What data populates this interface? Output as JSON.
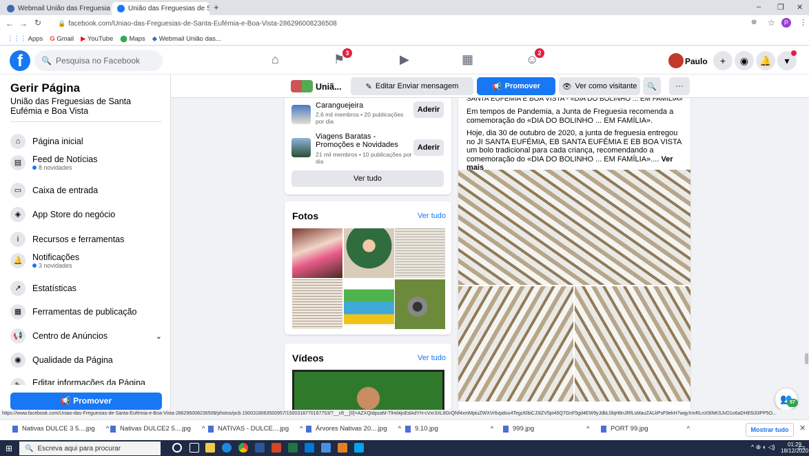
{
  "browser": {
    "tabs": [
      {
        "title": "Webmail União das Freguesias de..."
      },
      {
        "title": "União das Freguesias de Santa E..."
      }
    ],
    "new_tab": "+",
    "url": "facebook.com/Uniao-das-Freguesias-de-Santa-Eufémia-e-Boa-Vista-286296008236508",
    "bookmarks": [
      "Apps",
      "Gmail",
      "YouTube",
      "Maps",
      "Webmail União das..."
    ],
    "profile_initial": "P"
  },
  "header": {
    "search_placeholder": "Pesquisa no Facebook",
    "notif_badge_1": "3",
    "notif_badge_2": "2",
    "user": "Paulo"
  },
  "sidebar": {
    "title": "Gerir Página",
    "page_name": "União das Freguesias de Santa Eufémia e Boa Vista",
    "items": [
      {
        "label": "Página inicial",
        "sub": ""
      },
      {
        "label": "Feed de Notícias",
        "sub": "8 novidades"
      },
      {
        "label": "Caixa de entrada",
        "sub": ""
      },
      {
        "label": "App Store do negócio",
        "sub": ""
      },
      {
        "label": "Recursos e ferramentas",
        "sub": ""
      },
      {
        "label": "Notificações",
        "sub": "3 novidades"
      },
      {
        "label": "Estatísticas",
        "sub": ""
      },
      {
        "label": "Ferramentas de publicação",
        "sub": ""
      },
      {
        "label": "Centro de Anúncios",
        "sub": ""
      },
      {
        "label": "Qualidade da Página",
        "sub": ""
      },
      {
        "label": "Editar informações da Página",
        "sub": ""
      }
    ],
    "promote": "Promover"
  },
  "pagebar": {
    "short_name": "Uniã...",
    "edit_button": "Editar Enviar mensagem",
    "promote_button": "Promover",
    "visitor_button": "Ver como visitante",
    "more": "···"
  },
  "groups": {
    "items": [
      {
        "name": "Caranguejeira",
        "meta": "2,6 mil membros • 20 publicações por dia",
        "join": "Aderir"
      },
      {
        "name": "Viagens Baratas - Promoções e Novidades",
        "meta": "21 mil membros • 10 publicações por dia",
        "join": "Aderir"
      }
    ],
    "see_all": "Ver tudo"
  },
  "photos": {
    "title": "Fotos",
    "see_all": "Ver tudo"
  },
  "videos": {
    "title": "Vídeos",
    "see_all": "Ver tudo"
  },
  "post": {
    "heading": "SANTA EUFÉMIA E BOA VISTA - «DIA DO BOLINHO ... EM FAMÍLIA»",
    "para1": "Em tempos de Pandemia, a Junta de Freguesia recomenda a comemoração do «DIA DO BOLINHO ... EM FAMÍLIA».",
    "para2": "Hoje, dia 30 de outubro de 2020, a junta de freguesia entregou no JI SANTA EUFÉMIA, EB SANTA EUFÉMIA E EB BOA VISTA um bolo tradicional para cada criança, recomendando a comemoração do «DIA DO BOLINHO ... EM FAMÍLIA»....",
    "see_more": "Ver mais"
  },
  "status_url": "https://www.facebook.com/Uniao-das-Freguesias-de-Santa-Eufémia-e-Boa-Vista-286296008236508/photos/pcb.1500318063500957/1500318770167753/?__cft__[0]=AZXQIdpzaM-TlHd4joEdAdYH-cVxr3XL8GrQNf4xmMpiuZWXVr6vpdou4TegcKlbiCJ3iZV5pt45Q7GnF5gd4EW9yJdbL0lqH8nJRfLsMauZALkPsF9ekH7wqyXmRLnX9iNKSJvD1o6aDHE6i33PP5O...",
  "downloads": {
    "items": [
      "Nativas DULCE 3 5....jpg",
      "Nativas DULCE2 5....jpg",
      "NATIVAS - DULCE....jpg",
      "Árvores Nativas 20....jpg",
      "9.10.jpg",
      "999.jpg",
      "PORT 99.jpg"
    ],
    "show_all": "Mostrar tudo"
  },
  "taskbar": {
    "search": "Escreva aqui para procurar",
    "time": "01:29",
    "date": "18/12/2020"
  },
  "chat_badge": "57"
}
